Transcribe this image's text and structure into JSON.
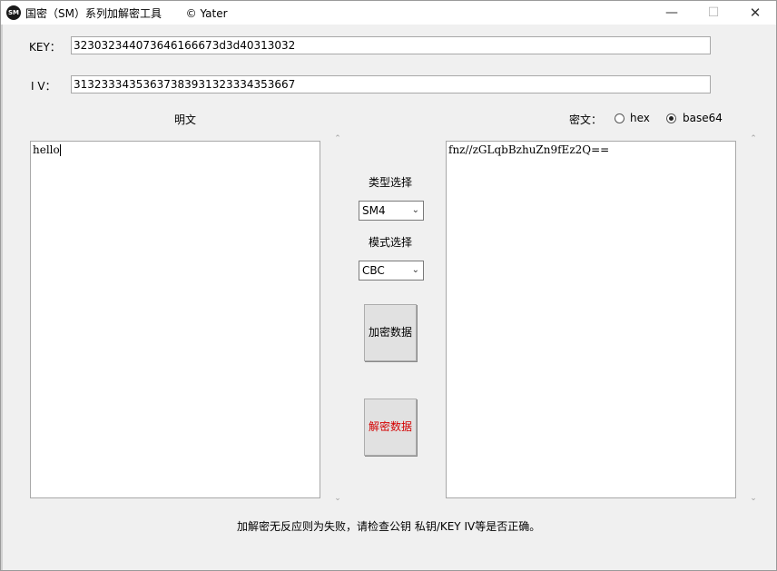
{
  "window": {
    "title": "国密（SM）系列加解密工具       © Yater",
    "app_icon": "SM",
    "minimize": "—",
    "maximize": "☐",
    "close": "✕"
  },
  "key": {
    "label": "KEY：",
    "value": "32303234407364616667 3d3d40313032"
  },
  "iv": {
    "label": "I V：",
    "value": "31323334353637383931323334353667"
  },
  "plaintext": {
    "label": "明文",
    "value": "hello"
  },
  "ciphertext": {
    "label": "密文：",
    "options": [
      "hex",
      "base64"
    ],
    "selected": "base64",
    "value": "fnz//zGLqbBzhuZn9fEz2Q=="
  },
  "type_select": {
    "label": "类型选择",
    "value": "SM4"
  },
  "mode_select": {
    "label": "模式选择",
    "value": "CBC"
  },
  "encrypt_button": {
    "label": "加密数据"
  },
  "decrypt_button": {
    "label": "解密数据",
    "color": "#d40000"
  },
  "status_message": "加解密无反应则为失败，请检查公钥 私钥/KEY IV等是否正确。",
  "icons": {
    "scroll_up": "up-arrow-icon",
    "scroll_down": "down-arrow-icon",
    "dropdown": "chevron-down-icon"
  }
}
